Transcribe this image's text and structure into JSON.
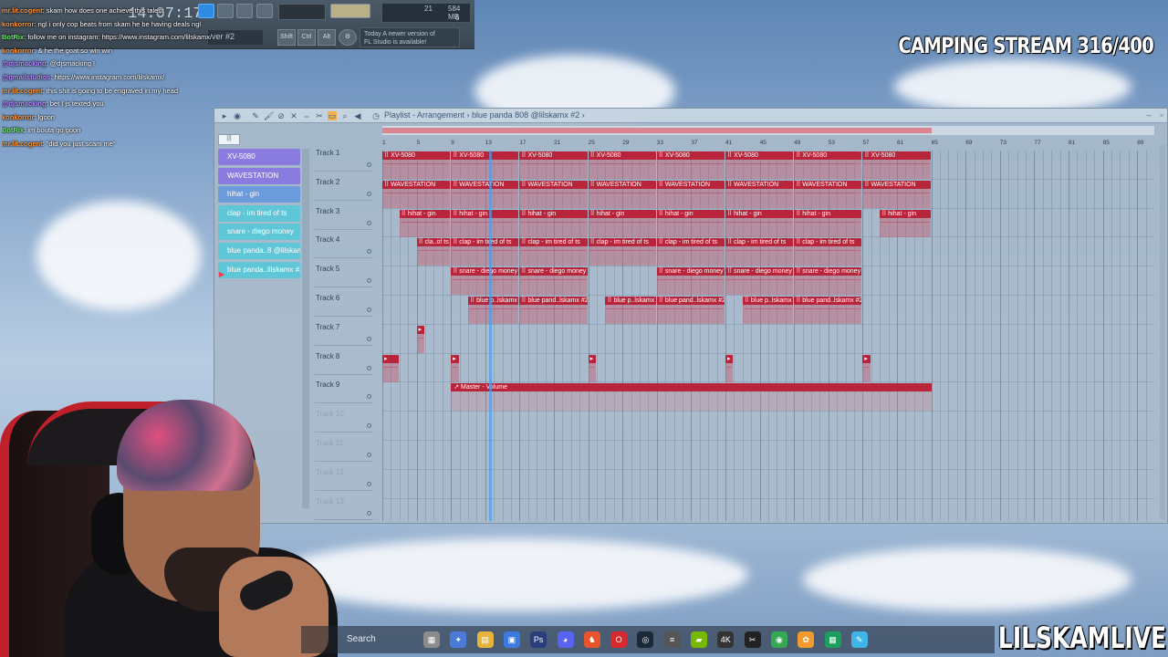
{
  "fl_toolbar": {
    "time": "14:07:17",
    "cpu_value": "21",
    "memory": "584 MB",
    "poly": "6",
    "pattern": "ver #2",
    "hint_line1": "Today  A newer version of",
    "hint_line2": "FL Studio is available!",
    "snap_buttons": [
      "Shift",
      "Ctrl",
      "Alt"
    ]
  },
  "chat": [
    {
      "user": "mr.lit.cogent",
      "text": ": skam how does one achieve this talent",
      "color": "#ff9a3c"
    },
    {
      "user": "konkorror",
      "text": ": ngl i only cop beats from skam he be having deals ngl",
      "color": "#ff9a3c"
    },
    {
      "user": "BotRix",
      "text": ": follow me on instagram: https://www.instagram.com/lilskamx/",
      "color": "#6cf06c"
    },
    {
      "user": "konkorror",
      "text": ": & he the goat so win win",
      "color": "#ff9a3c"
    },
    {
      "user": "@djsmacking",
      "text": ": @djsmacking !",
      "color": "#b98cff"
    },
    {
      "user": "@gmailstudios",
      "text": ": https://www.instagram.com/lilskamx/",
      "color": "#b98cff"
    },
    {
      "user": "mr.lit.cogent",
      "text": ": this shit is going to be engraved in my head",
      "color": "#ff9a3c"
    },
    {
      "user": "@djsmacking",
      "text": ": bet I js texted you",
      "color": "#b98cff"
    },
    {
      "user": "konkorror",
      "text": ": lgoon",
      "color": "#ff9a3c"
    },
    {
      "user": "BotRix",
      "text": ": im bouta go goon",
      "color": "#6cf06c"
    },
    {
      "user": "mr.lit.cogent",
      "text": ": \"did you just scam me\"",
      "color": "#ff9a3c"
    }
  ],
  "overlay": {
    "stream_title": "CAMPING STREAM 316/400",
    "channel_name": "LILSKAMLIVE"
  },
  "playlist": {
    "title": "Playlist - Arrangement",
    "breadcrumb": "blue panda 808 @lilskamx #2",
    "picker_tab": "|||",
    "picker": [
      {
        "label": "XV-5080",
        "color": "violet"
      },
      {
        "label": "WAVESTATION",
        "color": "violet"
      },
      {
        "label": "hihat - gin",
        "color": "blue"
      },
      {
        "label": "clap - im tired of ts",
        "color": "teal"
      },
      {
        "label": "snare - diego money",
        "color": "teal"
      },
      {
        "label": "blue panda..8 @lilskamx",
        "color": "teal"
      },
      {
        "label": "blue panda..lilskamx #2",
        "color": "teal"
      }
    ],
    "tracks": [
      "Track 1",
      "Track 2",
      "Track 3",
      "Track 4",
      "Track 5",
      "Track 6",
      "Track 7",
      "Track 8",
      "Track 9",
      "Track 10",
      "Track 11",
      "Track 12",
      "Track 13"
    ],
    "ruler": [
      "1",
      "5",
      "9",
      "13",
      "17",
      "21",
      "25",
      "29",
      "33",
      "37",
      "41",
      "45",
      "49",
      "53",
      "57",
      "61",
      "65",
      "69",
      "73",
      "77",
      "81",
      "85",
      "89"
    ],
    "clips": [
      {
        "track": 1,
        "start": 1,
        "len": 8,
        "label": "XV-5080",
        "repeat": 8
      },
      {
        "track": 2,
        "start": 1,
        "len": 8,
        "label": "WAVESTATION",
        "repeat": 8
      },
      {
        "track": 3,
        "start": 3,
        "len": 6,
        "label": "hihat - gin",
        "repeat": 1
      },
      {
        "track": 3,
        "start": 9,
        "len": 8,
        "label": "hihat - gin",
        "repeat": 6
      },
      {
        "track": 3,
        "start": 59,
        "len": 6,
        "label": "hihat - gin",
        "repeat": 1
      },
      {
        "track": 4,
        "start": 5,
        "len": 4,
        "label": "cla..of ts",
        "repeat": 1
      },
      {
        "track": 4,
        "start": 9,
        "len": 8,
        "label": "clap - im tired of ts",
        "repeat": 6
      },
      {
        "track": 5,
        "start": 9,
        "len": 8,
        "label": "snare - diego money",
        "repeat": 2
      },
      {
        "track": 5,
        "start": 33,
        "len": 8,
        "label": "snare - diego money",
        "repeat": 3
      },
      {
        "track": 6,
        "start": 11,
        "len": 6,
        "label": "blue p..lskamx",
        "repeat": 1
      },
      {
        "track": 6,
        "start": 17,
        "len": 8,
        "label": "blue pand..lskamx #2",
        "repeat": 1
      },
      {
        "track": 6,
        "start": 27,
        "len": 6,
        "label": "blue p..lskamx",
        "repeat": 1
      },
      {
        "track": 6,
        "start": 33,
        "len": 8,
        "label": "blue pand..lskamx #2",
        "repeat": 1
      },
      {
        "track": 6,
        "start": 43,
        "len": 6,
        "label": "blue p..lskamx",
        "repeat": 1
      },
      {
        "track": 6,
        "start": 49,
        "len": 8,
        "label": "blue pand..lskamx #2",
        "repeat": 1
      },
      {
        "track": 7,
        "start": 5,
        "len": 1,
        "label": "",
        "repeat": 1
      },
      {
        "track": 8,
        "start": 1,
        "len": 2,
        "label": "",
        "repeat": 1
      },
      {
        "track": 8,
        "start": 9,
        "len": 1,
        "label": "",
        "repeat": 1
      },
      {
        "track": 8,
        "start": 25,
        "len": 1,
        "label": "",
        "repeat": 1
      },
      {
        "track": 8,
        "start": 41,
        "len": 1,
        "label": "",
        "repeat": 1
      },
      {
        "track": 8,
        "start": 57,
        "len": 1,
        "label": "",
        "repeat": 1
      }
    ],
    "automation": {
      "track": 9,
      "start": 9,
      "len": 56,
      "label": "Master - Volume"
    }
  },
  "taskbar": {
    "search": "Search",
    "icons": [
      "widgets-icon",
      "copilot-icon",
      "folder-icon",
      "store-icon",
      "photoshop-icon",
      "discord-icon",
      "brave-icon",
      "opera-icon",
      "steam-icon",
      "msi-icon",
      "nvidia-icon",
      "4k-icon",
      "capcut-icon",
      "chrome-icon",
      "fl-studio-icon",
      "sheets-icon",
      "notepad-icon"
    ]
  }
}
